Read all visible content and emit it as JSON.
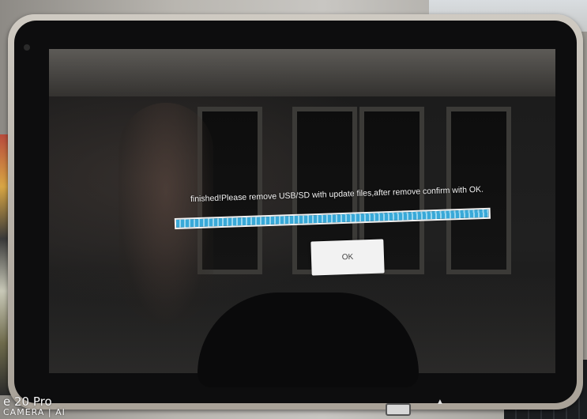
{
  "screen": {
    "message": "finished!Please remove USB/SD with update files,after remove confirm with OK.",
    "progress": 1.0,
    "ok_label": "OK"
  },
  "watermark": {
    "model": "e 20 Pro",
    "camera": "CAMERA | AI"
  },
  "colors": {
    "progress_fill": "#39a9d8",
    "button_bg": "#f2f2f2",
    "bezel": "#0d0d0e"
  },
  "icons": [
    "eject-icon"
  ]
}
